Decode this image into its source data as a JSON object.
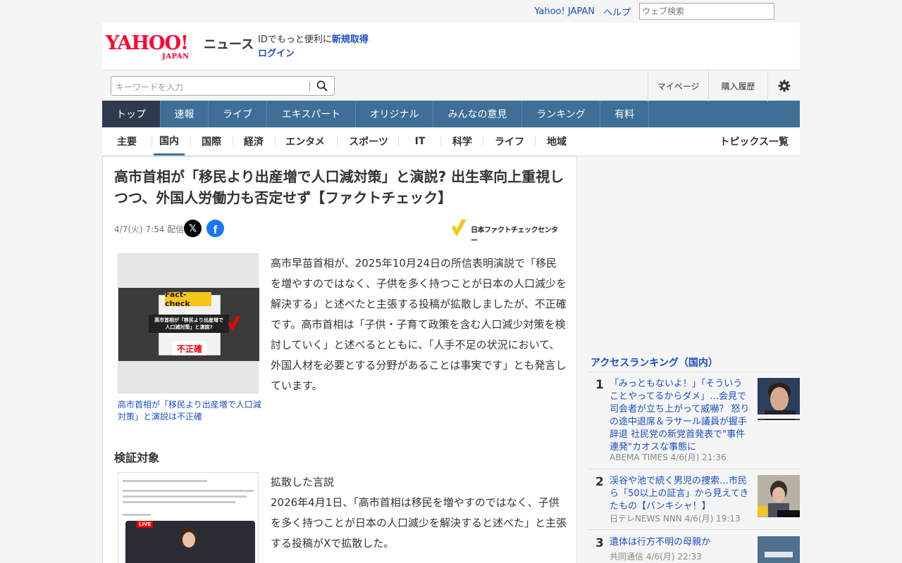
{
  "topbar": {
    "yahoo_japan": "Yahoo! JAPAN",
    "help": "ヘルプ",
    "web_search_placeholder": "ウェブ検索"
  },
  "logo": {
    "yahoo": "YAHOO!",
    "japan": "JAPAN",
    "news": "ニュース"
  },
  "id_box": {
    "prompt": "IDでもっと便利に",
    "signup": "新規取得",
    "login": "ログイン"
  },
  "search": {
    "placeholder": "キーワードを入力"
  },
  "tools": {
    "mypage": "マイページ",
    "purchase_history": "購入履歴"
  },
  "main_nav": [
    "トップ",
    "速報",
    "ライブ",
    "エキスパート",
    "オリジナル",
    "みんなの意見",
    "ランキング",
    "有料"
  ],
  "sub_nav": [
    "主要",
    "国内",
    "国際",
    "経済",
    "エンタメ",
    "スポーツ",
    "IT",
    "科学",
    "ライフ",
    "地域"
  ],
  "topics_list": "トピックス一覧",
  "article": {
    "title": "高市首相が「移民より出産増で人口減対策」と演説? 出生率向上重視しつつ、外国人労働力も否定せず【ファクトチェック】",
    "date": "4/7(火) 7:54",
    "delivered": "配信",
    "x_label": "𝕏",
    "fb_label": "f",
    "publisher": "日本ファクトチェックセンター",
    "figure": {
      "factcheck": "Fact-check",
      "headline_l1": "高市首相が「移民より出産増で",
      "headline_l2": "人口減対策」と演説?",
      "verdict": "不正確",
      "caption": "高市首相が「移民より出産増で人口減対策」と演説は不正確"
    },
    "body": "高市早苗首相が、2025年10月24日の所信表明演説で「移民を増やすのではなく、子供を多く持つことが日本の人口減少を解決する」と述べたと主張する投稿が拡散しましたが、不正確です。高市首相は「子供・子育て政策を含む人口減少対策を検討していく」と述べるとともに、「人手不足の状況において、外国人材を必要とする分野があることは事実です」とも発言しています。",
    "section_heading": "検証対象",
    "figure2": {
      "live": "LIVE"
    },
    "body2_label": "拡散した言説",
    "body2": "2026年4月1日、「高市首相は移民を増やすのではなく、子供を多く持つことが日本の人口減少を解決すると述べた」と主張する投稿がXで拡散した。"
  },
  "ranking": {
    "heading": "アクセスランキング（国内）",
    "items": [
      {
        "rank": "1",
        "title": "「みっともないよ！」「そういうことやってるからダメ」…会見で司会者が立ち上がって威嚇？ 怒りの途中退席＆ラサール議員が握手辞退 社民党の新党首発表で\"事件連発\"カオスな事態に",
        "source": "ABEMA TIMES 4/6(月) 21:36"
      },
      {
        "rank": "2",
        "title": "渓谷や池で続く男児の捜索…市民ら「50以上の証言」から見えてきたもの【バンキシャ！】",
        "source": "日テレNEWS NNN 4/6(月) 19:13"
      },
      {
        "rank": "3",
        "title": "遺体は行方不明の母親か",
        "source": "共同通信 4/6(月) 22:33"
      }
    ]
  }
}
